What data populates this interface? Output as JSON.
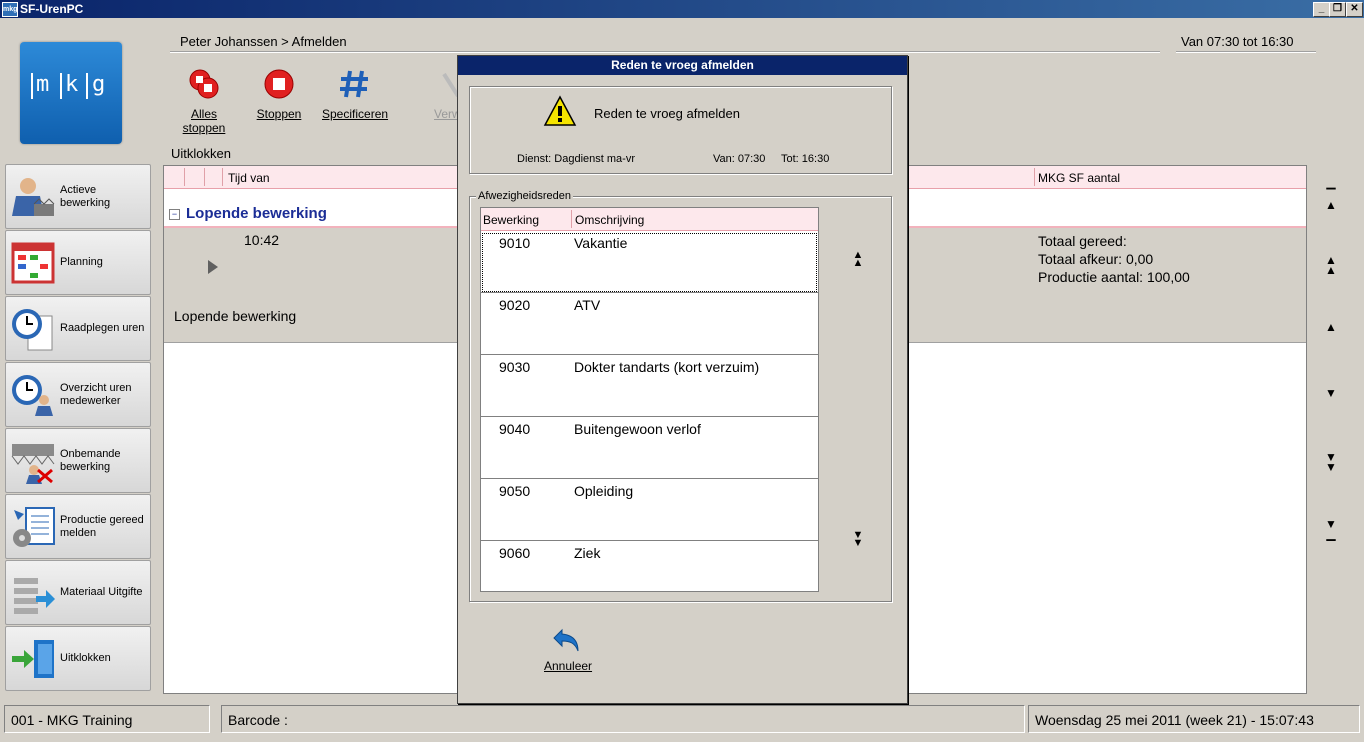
{
  "window": {
    "title": "SF-UrenPC",
    "icon_text": "mkg"
  },
  "logo": {
    "letters": [
      "m",
      "k",
      "g"
    ]
  },
  "sidebar": {
    "items": [
      {
        "label": "Actieve bewerking",
        "icon": "worker-icon"
      },
      {
        "label": "Planning",
        "icon": "planning-calendar-icon"
      },
      {
        "label": "Raadplegen uren",
        "icon": "clock-document-icon"
      },
      {
        "label": "Overzicht uren medewerker",
        "icon": "clock-person-icon"
      },
      {
        "label": "Onbemande bewerking",
        "icon": "unmanned-icon"
      },
      {
        "label": "Productie gereed melden",
        "icon": "production-report-icon"
      },
      {
        "label": "Materiaal Uitgifte",
        "icon": "material-issue-icon"
      },
      {
        "label": "Uitklokken",
        "icon": "door-exit-icon"
      }
    ]
  },
  "header": {
    "breadcrumb": "Peter Johanssen > Afmelden",
    "shift": "Van 07:30 tot 16:30"
  },
  "toolbar": {
    "stop_all": "Alles stoppen",
    "stop": "Stoppen",
    "specify": "Specificeren",
    "hidden": "Verw"
  },
  "main": {
    "section_label": "Uitklokken",
    "columns": {
      "time_from": "Tijd van",
      "mkg_sf": "MKG SF aantal"
    },
    "group_title": "Lopende bewerking",
    "group_toggle": "−",
    "row": {
      "time": "10:42",
      "label": "Lopende bewerking",
      "totaal_gereed": "Totaal gereed:",
      "totaal_afkeur": "Totaal afkeur: 0,00",
      "productie_aantal": "Productie aantal: 100,00"
    }
  },
  "dialog": {
    "title": "Reden te vroeg afmelden",
    "heading": "Reden te vroeg afmelden",
    "dienst": "Dienst: Dagdienst ma-vr",
    "van": "Van: 07:30",
    "tot": "Tot: 16:30",
    "group_label": "Afwezigheidsreden",
    "list_headers": {
      "code": "Bewerking",
      "desc": "Omschrijving"
    },
    "reasons": [
      {
        "code": "9010",
        "desc": "Vakantie"
      },
      {
        "code": "9020",
        "desc": "ATV"
      },
      {
        "code": "9030",
        "desc": "Dokter tandarts (kort verzuim)"
      },
      {
        "code": "9040",
        "desc": "Buitengewoon verlof"
      },
      {
        "code": "9050",
        "desc": "Opleiding"
      },
      {
        "code": "9060",
        "desc": "Ziek"
      }
    ],
    "cancel": "Annuleer"
  },
  "statusbar": {
    "company": "001 - MKG Training",
    "barcode": "Barcode :",
    "datetime": "Woensdag 25 mei 2011 (week 21)  - 15:07:43"
  },
  "colors": {
    "title_bar": "#0a246a",
    "grid_header": "#fde8ec",
    "group_text": "#1b2d96",
    "accent": "#1e73c8"
  }
}
